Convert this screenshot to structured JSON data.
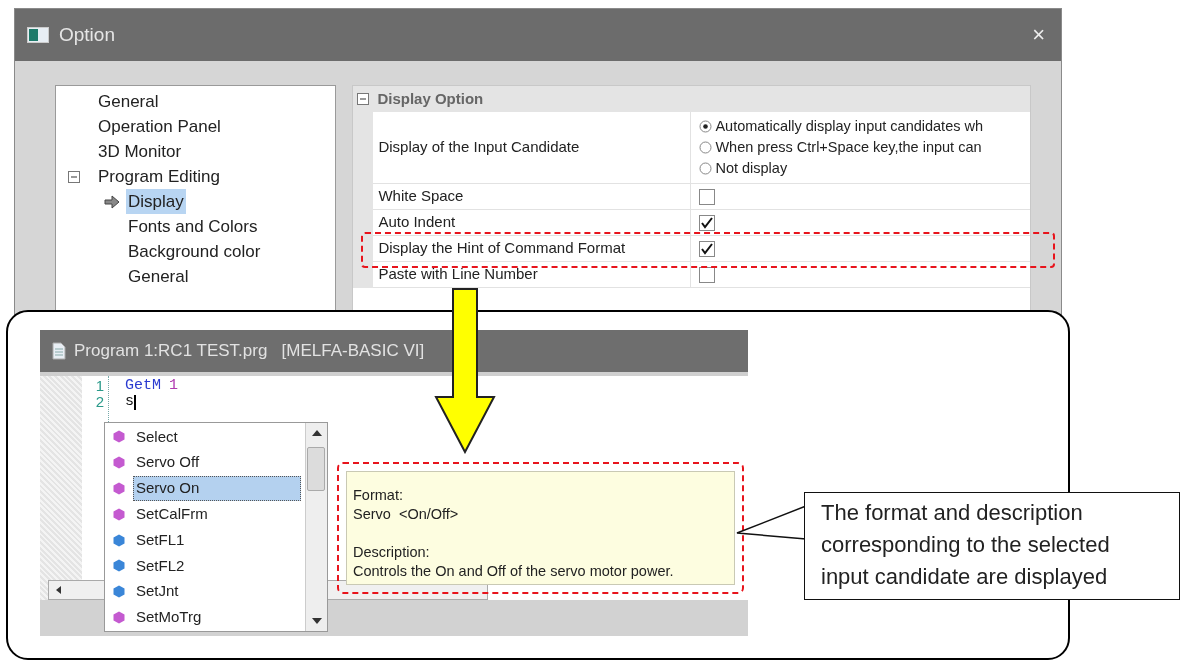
{
  "option_window": {
    "title": "Option",
    "close": "×",
    "tree": [
      {
        "label": "General",
        "selected": false
      },
      {
        "label": "Operation Panel",
        "selected": false
      },
      {
        "label": "3D Monitor",
        "selected": false
      },
      {
        "label": "Program Editing",
        "selected": false,
        "expanded": true,
        "children": [
          {
            "label": "Display",
            "selected": true
          },
          {
            "label": "Fonts and Colors",
            "selected": false
          },
          {
            "label": "Background color",
            "selected": false
          },
          {
            "label": "General",
            "selected": false
          }
        ]
      }
    ],
    "section": {
      "title": "Display Option",
      "expanded": true
    },
    "rows": [
      {
        "kind": "radio",
        "label": "Display of the Input Candidate",
        "options": [
          {
            "label": "Automatically display input candidates wh",
            "selected": true
          },
          {
            "label": "When press Ctrl+Space key,the input can",
            "selected": false
          },
          {
            "label": "Not display",
            "selected": false
          }
        ]
      },
      {
        "kind": "checkbox",
        "label": "White Space",
        "checked": false
      },
      {
        "kind": "checkbox",
        "label": "Auto Indent",
        "checked": true
      },
      {
        "kind": "checkbox",
        "label": "Display the Hint of Command Format",
        "checked": true,
        "highlighted": true
      },
      {
        "kind": "checkbox",
        "label": "Paste with Line Number",
        "checked": false
      }
    ]
  },
  "editor_window": {
    "title": "Program 1:RC1 TEST.prg   [MELFA-BASIC VI]",
    "lines": [
      {
        "number": "1",
        "tokens": [
          {
            "text": "GetM",
            "kind": "keyword"
          },
          {
            "text": "1",
            "kind": "number"
          }
        ]
      },
      {
        "number": "2",
        "tokens": [
          {
            "text": "s",
            "kind": "plain"
          }
        ],
        "caret": true
      }
    ],
    "candidates": [
      {
        "label": "Select",
        "color": "#c45ad0",
        "selected": false
      },
      {
        "label": "Servo Off",
        "color": "#c45ad0",
        "selected": false
      },
      {
        "label": "Servo On",
        "color": "#c45ad0",
        "selected": true
      },
      {
        "label": "SetCalFrm",
        "color": "#c45ad0",
        "selected": false
      },
      {
        "label": "SetFL1",
        "color": "#3a86d8",
        "selected": false
      },
      {
        "label": "SetFL2",
        "color": "#3a86d8",
        "selected": false
      },
      {
        "label": "SetJnt",
        "color": "#3a86d8",
        "selected": false
      },
      {
        "label": "SetMoTrg",
        "color": "#c45ad0",
        "selected": false
      }
    ],
    "hint": {
      "format_label": "Format:",
      "format": "Servo  <On/Off>",
      "description_label": "Description:",
      "description": "Controls the On and Off of the servo motor power.",
      "highlighted": true
    }
  },
  "callout": {
    "text": "The format and description corresponding to the selected input candidate are displayed"
  }
}
